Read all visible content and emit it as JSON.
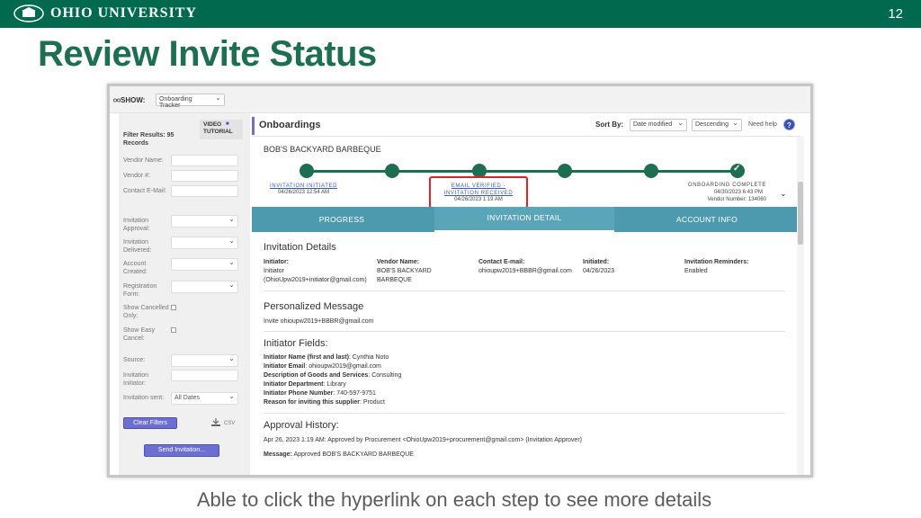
{
  "slide": {
    "logo_text": "OHIO UNIVERSITY",
    "page_number": "12",
    "title": "Review Invite Status",
    "caption": "Able to click the hyperlink on each step to see more details"
  },
  "app": {
    "show_label": "SHOW:",
    "show_select": "Onboarding Tracker",
    "sidebar": {
      "video_tutorial": "VIDEO TUTORIAL",
      "filter_results": "Filter Results: 95 Records",
      "vendor_name": "Vendor Name:",
      "vendor_num": "Vendor #:",
      "contact_email": "Contact E-Mail:",
      "invitation_approval": "Invitation Approval:",
      "invitation_delivered": "Invitation Delivered:",
      "account_created": "Account Created:",
      "registration_form": "Registration Form:",
      "show_cancelled": "Show Cancelled Only:",
      "show_easy_cancel": "Show Easy Cancel:",
      "source": "Source:",
      "invitation_initiator": "Invitation Initiator:",
      "invitation_sent": "Invitation sent:",
      "invitation_sent_value": "All Dates",
      "clear_filters": "Clear Filters",
      "csv": "CSV",
      "send_invitation": "Send Invitation..."
    },
    "header": {
      "title": "Onboardings",
      "sort_by": "Sort By:",
      "sort_field": "Date modified",
      "sort_order": "Descending",
      "need_help": "Need help",
      "help_icon": "?"
    },
    "vendor": "BOB'S BACKYARD BARBEQUE",
    "steps": {
      "first_link": "INVITATION INITIATED",
      "first_date": "04/26/2023 12:54 AM",
      "mid_link": "EMAIL VERIFIED - INVITATION RECEIVED",
      "mid_date": "04/26/2023 1:19 AM",
      "last_label": "ONBOARDING COMPLETE",
      "last_date": "04/30/2023 6:43 PM",
      "vendor_number": "Vendor Number: 134060"
    },
    "tabs": [
      "PROGRESS",
      "INVITATION DETAIL",
      "ACCOUNT INFO"
    ],
    "details": {
      "title": "Invitation Details",
      "initiator_label": "Initiator:",
      "initiator_value": "Initiator (OhioUpw2019+initiator@gmail.com)",
      "vendor_name_label": "Vendor Name:",
      "vendor_name_value": "BOB'S BACKYARD BARBEQUE",
      "contact_label": "Contact E-mail:",
      "contact_value": "ohioupw2019+BBBR@gmail.com",
      "initiated_label": "Initiated:",
      "initiated_value": "04/26/2023",
      "reminders_label": "Invitation Reminders:",
      "reminders_value": "Enabled"
    },
    "personalized": {
      "title": "Personalized Message",
      "message": "Invite ohioupw2019+BBBR@gmail.com"
    },
    "initiator_fields": {
      "title": "Initiator Fields:",
      "rows": [
        {
          "label": "Initiator Name (first and last)",
          "value": "Cynthia Noto"
        },
        {
          "label": "Initiator Email",
          "value": "ohioupw2019@gmail.com"
        },
        {
          "label": "Description of Goods and Services",
          "value": "Consulting"
        },
        {
          "label": "Initiator Department",
          "value": "Library"
        },
        {
          "label": "Initiator Phone Number",
          "value": "740-597-9751"
        },
        {
          "label": "Reason for inviting this supplier",
          "value": "Product"
        }
      ]
    },
    "approval": {
      "title": "Approval History:",
      "entry": "Apr 26, 2023 1:19 AM: Approved by Procurement <OhioUpw2019+procurement@gmail.com> (Invitation Approver)",
      "message_label": "Message:",
      "message_value": "Approved BOB'S BACKYARD BARBEQUE"
    }
  }
}
